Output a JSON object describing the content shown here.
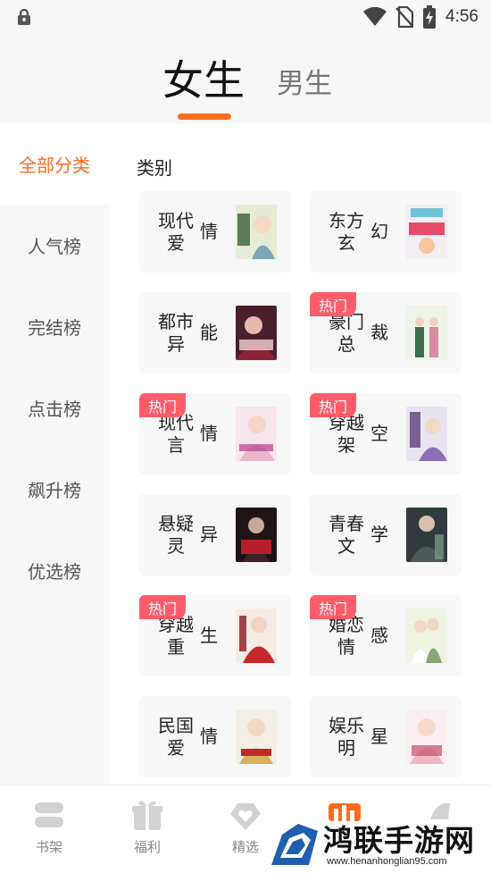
{
  "status_bar": {
    "time": "4:56",
    "icons": [
      "lock-icon",
      "wifi-icon",
      "no-sim-icon",
      "battery-charging-icon"
    ]
  },
  "gender_tabs": {
    "female": "女生",
    "male": "男生",
    "active_color": "#ff6a1f"
  },
  "sidebar": {
    "items": [
      {
        "label": "全部分类",
        "active": true
      },
      {
        "label": "人气榜",
        "active": false
      },
      {
        "label": "完结榜",
        "active": false
      },
      {
        "label": "点击榜",
        "active": false
      },
      {
        "label": "飙升榜",
        "active": false
      },
      {
        "label": "优选榜",
        "active": false
      }
    ]
  },
  "main": {
    "section_title": "类别",
    "badge_label": "热门",
    "badge_color": "#ff5c6a",
    "categories": [
      {
        "label": "现代爱情",
        "line1": "现代爱",
        "line2": "情",
        "hot": false,
        "cover": "cover-countryside-girl"
      },
      {
        "label": "东方玄幻",
        "line1": "东方玄",
        "line2": "幻",
        "hot": false,
        "cover": "cover-villain-wedding"
      },
      {
        "label": "都市异能",
        "line1": "都市异",
        "line2": "能",
        "hot": false,
        "cover": "cover-dark-romance"
      },
      {
        "label": "豪门总裁",
        "line1": "豪门总",
        "line2": "裁",
        "hot": true,
        "cover": "cover-couple-marriage"
      },
      {
        "label": "现代言情",
        "line1": "现代言",
        "line2": "情",
        "hot": true,
        "cover": "cover-pregnant-bride"
      },
      {
        "label": "穿越架空",
        "line1": "穿越架",
        "line2": "空",
        "hot": true,
        "cover": "cover-ancient-couple"
      },
      {
        "label": "悬疑灵异",
        "line1": "悬疑灵",
        "line2": "异",
        "hot": false,
        "cover": "cover-ghost-marriage"
      },
      {
        "label": "青春文学",
        "line1": "青春文",
        "line2": "学",
        "hot": false,
        "cover": "cover-young-man"
      },
      {
        "label": "穿越重生",
        "line1": "穿越重",
        "line2": "生",
        "hot": true,
        "cover": "cover-red-dress"
      },
      {
        "label": "婚恋情感",
        "line1": "婚恋情",
        "line2": "感",
        "hot": true,
        "cover": "cover-wedding-couple"
      },
      {
        "label": "民国爱情",
        "line1": "民国爱",
        "line2": "情",
        "hot": false,
        "cover": "cover-republic-lady"
      },
      {
        "label": "娱乐明星",
        "line1": "娱乐明",
        "line2": "星",
        "hot": false,
        "cover": "cover-star-girl"
      }
    ]
  },
  "bottom_nav": {
    "items": [
      {
        "label": "书架",
        "icon": "bookshelf-icon"
      },
      {
        "label": "福利",
        "icon": "gift-icon"
      },
      {
        "label": "精选",
        "icon": "heart-diamond-icon"
      }
    ]
  },
  "watermark": {
    "brand": "鸿联手游网",
    "url": "www.henanhonglian95.com"
  }
}
